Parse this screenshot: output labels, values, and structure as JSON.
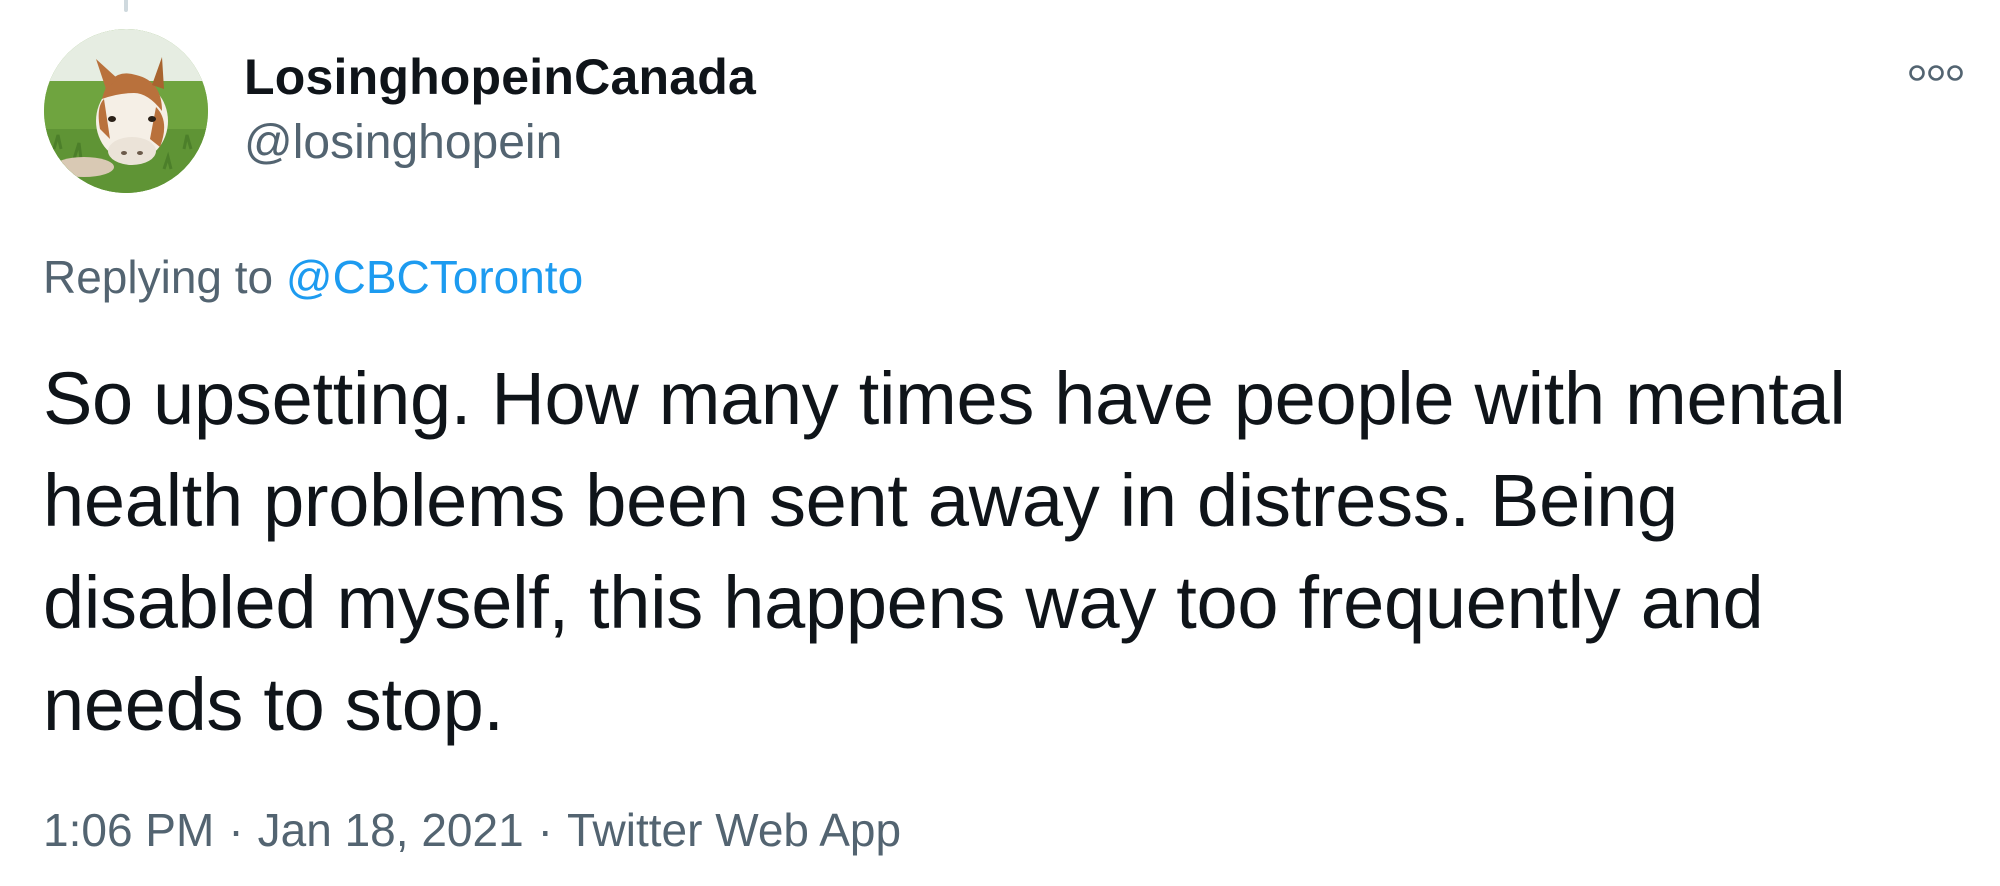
{
  "tweet": {
    "author": {
      "display_name": "LosinghopeinCanada",
      "handle": "@losinghopein",
      "avatar_icon": "pony-avatar"
    },
    "reply_context": {
      "prefix": "Replying to",
      "mention": "@CBCToronto"
    },
    "text": "So upsetting. How many times have people with mental\nhealth problems been sent away in distress. Being\ndisabled myself, this happens way too frequently and\nneeds to stop.",
    "time": "1:06 PM",
    "separator": "·",
    "date": "Jan 18, 2021",
    "source": "Twitter Web App",
    "more_icon": "more-options-icon"
  },
  "colors": {
    "text": "#0f1419",
    "secondary": "#536471",
    "link": "#1d9bf0",
    "background": "#ffffff"
  }
}
